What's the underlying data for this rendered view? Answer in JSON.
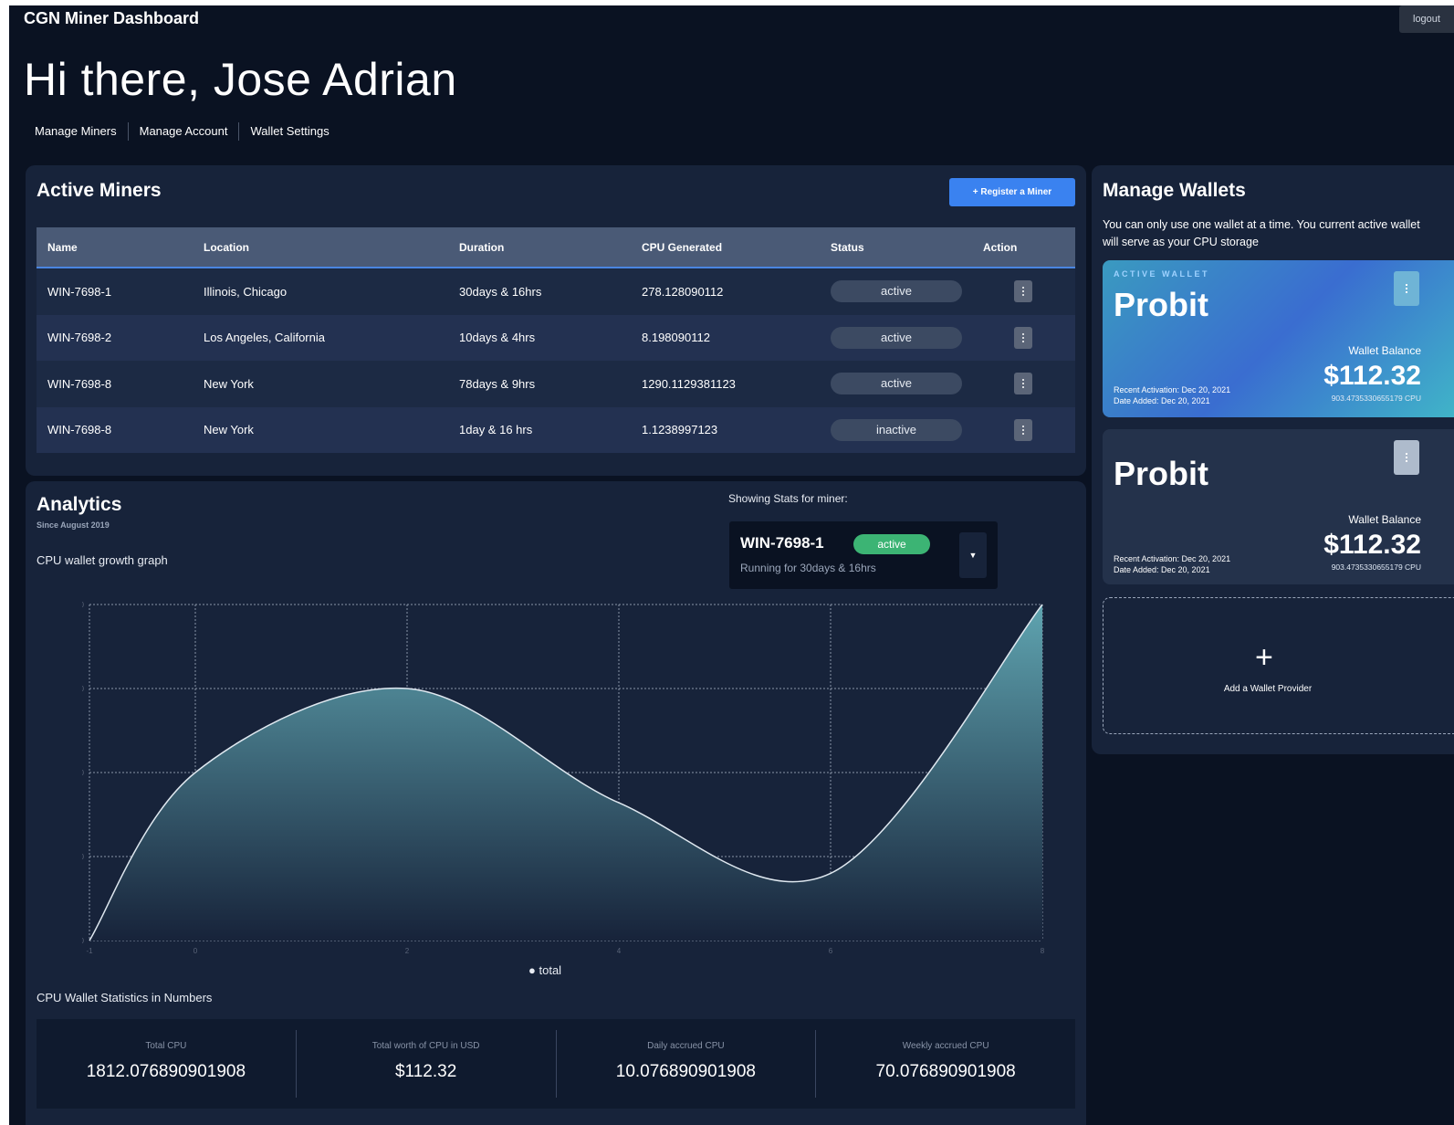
{
  "header": {
    "brand": "CGN Miner Dashboard",
    "logout_label": "logout",
    "greeting": "Hi there, Jose Adrian"
  },
  "nav": {
    "items": [
      "Manage Miners",
      "Manage Account",
      "Wallet Settings"
    ]
  },
  "miners": {
    "title": "Active Miners",
    "register_label": "+ Register a Miner",
    "columns": [
      "Name",
      "Location",
      "Duration",
      "CPU Generated",
      "Status",
      "Action"
    ],
    "rows": [
      {
        "name": "WIN-7698-1",
        "location": "Illinois, Chicago",
        "duration": "30days & 16hrs",
        "cpu": "278.128090112",
        "status": "active"
      },
      {
        "name": "WIN-7698-2",
        "location": "Los Angeles, California",
        "duration": "10days & 4hrs",
        "cpu": "8.198090112",
        "status": "active"
      },
      {
        "name": "WIN-7698-8",
        "location": "New York",
        "duration": "78days & 9hrs",
        "cpu": "1290.1129381123",
        "status": "active"
      },
      {
        "name": "WIN-7698-8",
        "location": "New York",
        "duration": "1day & 16 hrs",
        "cpu": "1.1238997123",
        "status": "inactive"
      }
    ]
  },
  "analytics": {
    "title": "Analytics",
    "since": "Since August 2019",
    "graph_label": "CPU wallet growth graph",
    "showing_label": "Showing Stats for miner:",
    "selected_miner": {
      "name": "WIN-7698-1",
      "status": "active",
      "running": "Running for 30days & 16hrs"
    },
    "stats_heading": "CPU Wallet Statistics in Numbers",
    "stats": [
      {
        "label": "Total CPU",
        "value": "1812.076890901908"
      },
      {
        "label": "Total worth of CPU in USD",
        "value": "$112.32"
      },
      {
        "label": "Daily accrued CPU",
        "value": "10.076890901908"
      },
      {
        "label": "Weekly accrued CPU",
        "value": "70.076890901908"
      }
    ]
  },
  "chart_data": {
    "type": "area",
    "x": [
      -1,
      0,
      2,
      4,
      6,
      8
    ],
    "series": [
      {
        "name": "total",
        "values": [
          0,
          100,
          150,
          82,
          40,
          200
        ]
      }
    ],
    "xticks": [
      -1,
      0,
      2,
      4,
      6,
      8
    ],
    "yticks": [
      0,
      50,
      100,
      150,
      200
    ],
    "xlim": [
      -1,
      8
    ],
    "ylim": [
      0,
      200
    ],
    "grid": true,
    "legend": "bottom",
    "line_color": "#dfe8f0",
    "fill_top_color": "#5fa4b0",
    "fill_bottom_color": "#17233a"
  },
  "wallets": {
    "title": "Manage Wallets",
    "description": "You can only use one wallet at a time. You current active wallet will serve as your CPU storage",
    "active_tag": "ACTIVE WALLET",
    "items": [
      {
        "name": "Probit",
        "balance_label": "Wallet Balance",
        "balance": "$112.32",
        "cpu": "903.4735330655179 CPU",
        "recent": "Recent Activation: Dec 20, 2021",
        "added": "Date Added: Dec 20, 2021"
      },
      {
        "name": "Probit",
        "balance_label": "Wallet Balance",
        "balance": "$112.32",
        "cpu": "903.4735330655179 CPU",
        "recent": "Recent Activation: Dec 20, 2021",
        "added": "Date Added: Dec 20, 2021"
      }
    ],
    "add_label": "Add a Wallet Provider",
    "add_symbol": "+"
  }
}
